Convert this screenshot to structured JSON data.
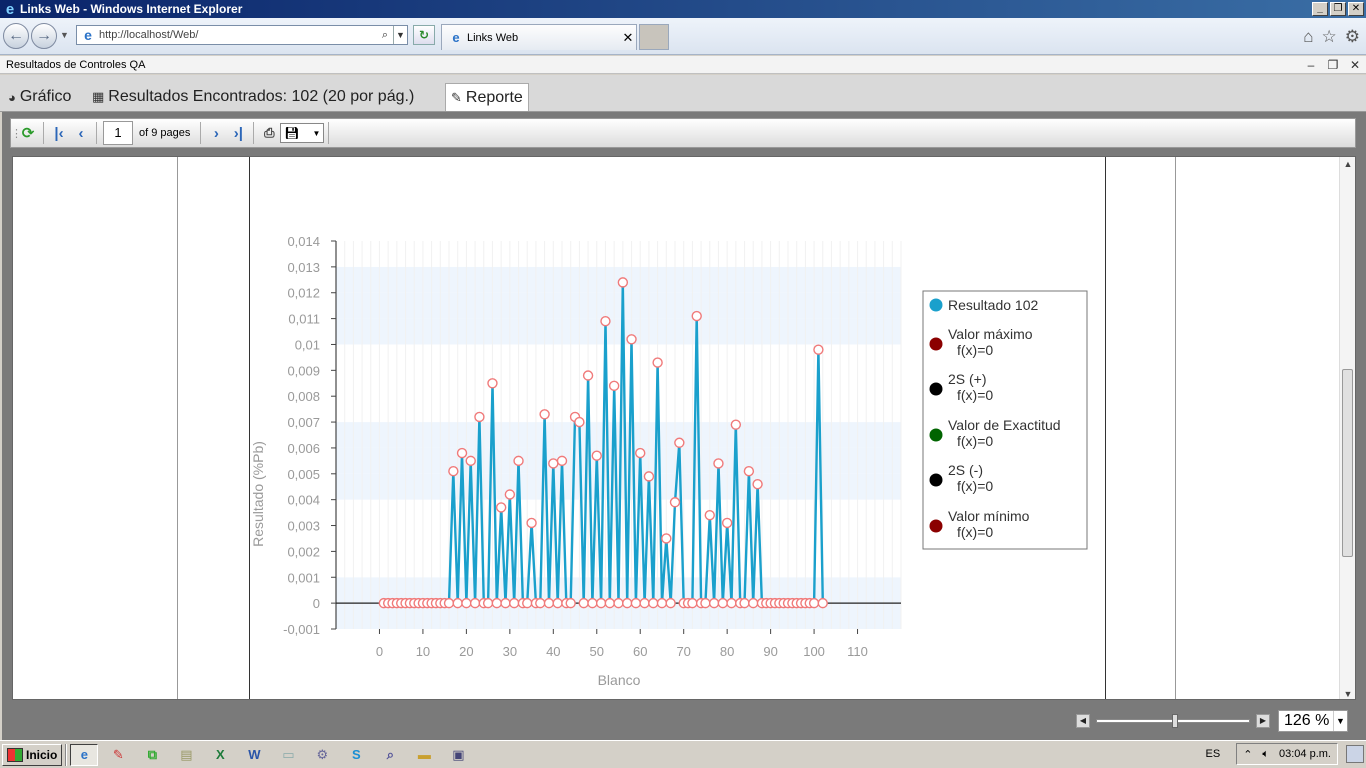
{
  "window": {
    "title": "Links Web - Windows Internet Explorer"
  },
  "browser": {
    "url": "http://localhost/Web/",
    "tab_title": "Links Web",
    "page_title": "Resultados de Controles QA"
  },
  "app_tabs": [
    {
      "label": "Gráfico",
      "icon": "chart-icon"
    },
    {
      "label": "Resultados Encontrados: 102 (20 por pág.)",
      "icon": "grid-icon"
    },
    {
      "label": "Reporte",
      "icon": "report-icon",
      "active": true
    }
  ],
  "report_toolbar": {
    "page_number": "1",
    "page_of_label": "of 9 pages"
  },
  "zoom": {
    "value": "126 %",
    "level_fraction": 0.5
  },
  "taskbar": {
    "start_label": "Inicio",
    "lang": "ES",
    "clock": "03:04 p.m."
  },
  "chart_data": {
    "type": "line",
    "xlabel": "Blanco",
    "ylabel": "Resultado (%Pb)",
    "xlim": [
      -10,
      120
    ],
    "ylim": [
      -0.001,
      0.014
    ],
    "x_ticks": [
      "0",
      "10",
      "20",
      "30",
      "40",
      "50",
      "60",
      "70",
      "80",
      "90",
      "100",
      "110"
    ],
    "y_ticks": [
      "-0,001",
      "0",
      "0,001",
      "0,002",
      "0,003",
      "0,004",
      "0,005",
      "0,006",
      "0,007",
      "0,008",
      "0,009",
      "0,01",
      "0,011",
      "0,012",
      "0,013",
      "0,014"
    ],
    "grid": true,
    "legend_position": "right",
    "series": [
      {
        "name": "Resultado 102",
        "color": "#1aa0cc",
        "x": [
          1,
          2,
          3,
          4,
          5,
          6,
          7,
          8,
          9,
          10,
          11,
          12,
          13,
          14,
          15,
          16,
          17,
          18,
          19,
          20,
          21,
          22,
          23,
          24,
          25,
          26,
          27,
          28,
          29,
          30,
          31,
          32,
          33,
          34,
          35,
          36,
          37,
          38,
          39,
          40,
          41,
          42,
          43,
          44,
          45,
          46,
          47,
          48,
          49,
          50,
          51,
          52,
          53,
          54,
          55,
          56,
          57,
          58,
          59,
          60,
          61,
          62,
          63,
          64,
          65,
          66,
          67,
          68,
          69,
          70,
          71,
          72,
          73,
          74,
          75,
          76,
          77,
          78,
          79,
          80,
          81,
          82,
          83,
          84,
          85,
          86,
          87,
          88,
          89,
          90,
          91,
          92,
          93,
          94,
          95,
          96,
          97,
          98,
          99,
          100,
          101,
          102
        ],
        "values": [
          0,
          0,
          0,
          0,
          0,
          0,
          0,
          0,
          0,
          0,
          0,
          0,
          0,
          0,
          0,
          0,
          0.0051,
          0,
          0.0058,
          0,
          0.0055,
          0,
          0.0072,
          0,
          0,
          0.0085,
          0,
          0.0037,
          0,
          0.0042,
          0,
          0.0055,
          0,
          0,
          0.0031,
          0,
          0,
          0.0073,
          0,
          0.0054,
          0,
          0.0055,
          0,
          0,
          0.0072,
          0.007,
          0,
          0.0088,
          0,
          0.0057,
          0,
          0.0109,
          0,
          0.0084,
          0,
          0.0124,
          0,
          0.0102,
          0,
          0.0058,
          0,
          0.0049,
          0,
          0.0093,
          0,
          0.0025,
          0,
          0.0039,
          0.0062,
          0,
          0,
          0,
          0.0111,
          0,
          0,
          0.0034,
          0,
          0.0054,
          0,
          0.0031,
          0,
          0.0069,
          0,
          0,
          0.0051,
          0,
          0.0046,
          0,
          0,
          0,
          0,
          0,
          0,
          0,
          0,
          0,
          0,
          0,
          0,
          0,
          0.0098,
          0
        ]
      },
      {
        "name": "Valor máximo",
        "formula": "f(x)=0",
        "color": "#8b0000",
        "values": [
          0
        ]
      },
      {
        "name": "2S (+)",
        "formula": "f(x)=0",
        "color": "#000000",
        "values": [
          0
        ]
      },
      {
        "name": "Valor de Exactitud",
        "formula": "f(x)=0",
        "color": "#006400",
        "values": [
          0
        ]
      },
      {
        "name": "2S (-)",
        "formula": "f(x)=0",
        "color": "#000000",
        "values": [
          0
        ]
      },
      {
        "name": "Valor mínimo",
        "formula": "f(x)=0",
        "color": "#8b0000",
        "values": [
          0
        ]
      }
    ]
  }
}
